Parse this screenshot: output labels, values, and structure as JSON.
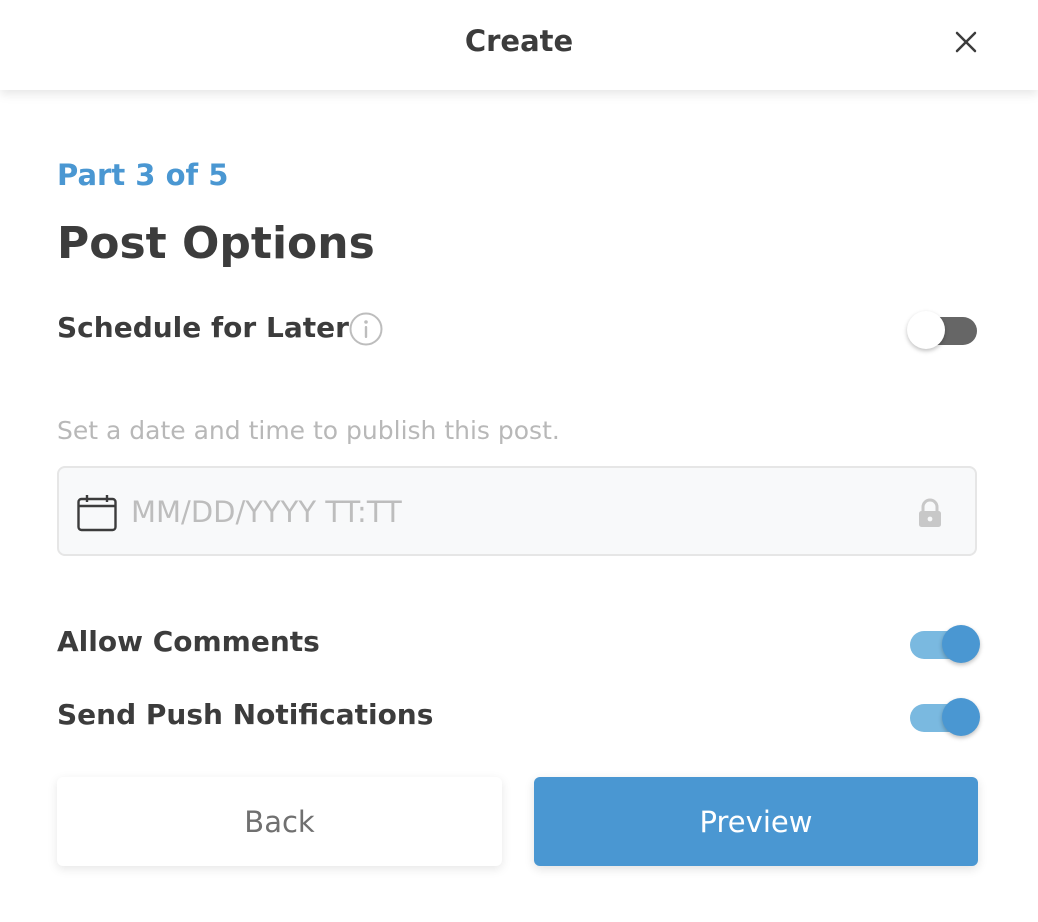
{
  "header": {
    "title": "Create",
    "close_icon": "close-icon"
  },
  "step": {
    "label": "Part 3 of 5",
    "current": 3,
    "total": 5
  },
  "page_title": "Post Options",
  "schedule": {
    "label": "Schedule for Later",
    "info_icon": "info-icon",
    "enabled": false,
    "hint": "Set a date and time to publish this post.",
    "date_field": {
      "value": "",
      "placeholder": "MM/DD/YYYY TT:TT",
      "icon": "calendar-icon",
      "locked": true,
      "lock_icon": "lock-icon"
    }
  },
  "options": [
    {
      "label": "Allow Comments",
      "enabled": true
    },
    {
      "label": "Send Push Notifications",
      "enabled": true
    }
  ],
  "buttons": {
    "back": "Back",
    "preview": "Preview"
  },
  "colors": {
    "accent": "#4a97d2",
    "toggle_on_track": "#7ab9e0",
    "toggle_off_track": "#666666",
    "text": "#3c3c3c",
    "hint": "#b8b8b8"
  }
}
